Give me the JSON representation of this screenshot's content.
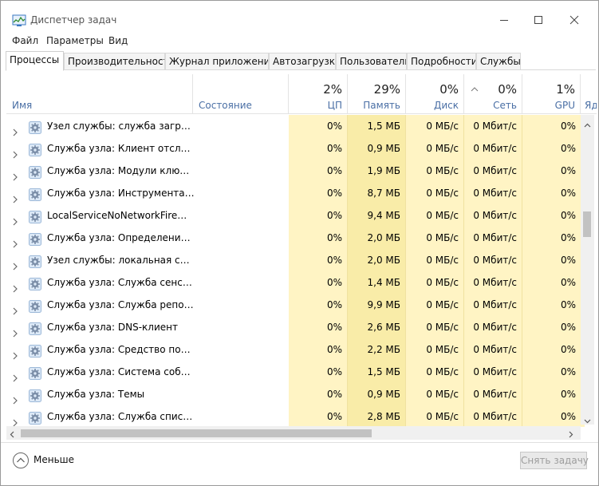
{
  "window": {
    "title": "Диспетчер задач"
  },
  "menu": [
    "Файл",
    "Параметры",
    "Вид"
  ],
  "tabs": [
    {
      "label": "Процессы",
      "active": true
    },
    {
      "label": "Производительность"
    },
    {
      "label": "Журнал приложений"
    },
    {
      "label": "Автозагрузка"
    },
    {
      "label": "Пользователи"
    },
    {
      "label": "Подробности"
    },
    {
      "label": "Службы"
    }
  ],
  "columns": {
    "name": "Имя",
    "status": "Состояние",
    "cpu": {
      "label": "ЦП",
      "total": "2%"
    },
    "memory": {
      "label": "Память",
      "total": "29%"
    },
    "disk": {
      "label": "Диск",
      "total": "0%"
    },
    "network": {
      "label": "Сеть",
      "total": "0%"
    },
    "gpu": {
      "label": "GPU",
      "total": "1%"
    },
    "gpu_engine": {
      "label": "Яд"
    }
  },
  "rows": [
    {
      "name": "Узел службы: служба загрузки...",
      "cpu": "0%",
      "mem": "1,5 МБ",
      "disk": "0 МБ/с",
      "net": "0 Мбит/с",
      "gpu": "0%"
    },
    {
      "name": "Служба узла: Клиент отслежи...",
      "cpu": "0%",
      "mem": "0,9 МБ",
      "disk": "0 МБ/с",
      "net": "0 Мбит/с",
      "gpu": "0%"
    },
    {
      "name": "Служба узла: Модули ключей ...",
      "cpu": "0%",
      "mem": "1,9 МБ",
      "disk": "0 МБ/с",
      "net": "0 Мбит/с",
      "gpu": "0%"
    },
    {
      "name": "Служба узла: Инструментари...",
      "cpu": "0%",
      "mem": "8,7 МБ",
      "disk": "0 МБ/с",
      "net": "0 Мбит/с",
      "gpu": "0%"
    },
    {
      "name": "LocalServiceNoNetworkFirewall ...",
      "cpu": "0%",
      "mem": "9,4 МБ",
      "disk": "0 МБ/с",
      "net": "0 Мбит/с",
      "gpu": "0%"
    },
    {
      "name": "Служба узла: Определение об...",
      "cpu": "0%",
      "mem": "2,0 МБ",
      "disk": "0 МБ/с",
      "net": "0 Мбит/с",
      "gpu": "0%"
    },
    {
      "name": "Узел службы: локальная служ...",
      "cpu": "0%",
      "mem": "2,0 МБ",
      "disk": "0 МБ/с",
      "net": "0 Мбит/с",
      "gpu": "0%"
    },
    {
      "name": "Служба узла: Служба сенсорн...",
      "cpu": "0%",
      "mem": "1,4 МБ",
      "disk": "0 МБ/с",
      "net": "0 Мбит/с",
      "gpu": "0%"
    },
    {
      "name": "Служба узла: Служба репозит...",
      "cpu": "0%",
      "mem": "9,9 МБ",
      "disk": "0 МБ/с",
      "net": "0 Мбит/с",
      "gpu": "0%"
    },
    {
      "name": "Служба узла: DNS-клиент",
      "cpu": "0%",
      "mem": "2,6 МБ",
      "disk": "0 МБ/с",
      "net": "0 Мбит/с",
      "gpu": "0%"
    },
    {
      "name": "Служба узла: Средство постро...",
      "cpu": "0%",
      "mem": "2,2 МБ",
      "disk": "0 МБ/с",
      "net": "0 Мбит/с",
      "gpu": "0%"
    },
    {
      "name": "Служба узла: Система событи...",
      "cpu": "0%",
      "mem": "1,5 МБ",
      "disk": "0 МБ/с",
      "net": "0 Мбит/с",
      "gpu": "0%"
    },
    {
      "name": "Служба узла: Темы",
      "cpu": "0%",
      "mem": "0,9 МБ",
      "disk": "0 МБ/с",
      "net": "0 Мбит/с",
      "gpu": "0%"
    },
    {
      "name": "Служба узла: Служба списка с...",
      "cpu": "0%",
      "mem": "2,8 МБ",
      "disk": "0 МБ/с",
      "net": "0 Мбит/с",
      "gpu": "0%"
    }
  ],
  "footer": {
    "less_label": "Меньше",
    "end_task_label": "Снять задачу"
  },
  "colors": {
    "cpu_cell": "#fff4c4",
    "mem_cell": "#f9eca8",
    "header_label": "#4a6fa5"
  },
  "icons": {
    "app": "task-manager-icon",
    "row": "gear-icon",
    "expand": "chevron-right-icon",
    "less": "chevron-up-circle-icon"
  }
}
